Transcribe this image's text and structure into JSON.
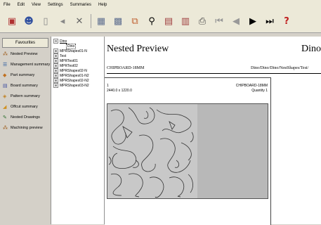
{
  "menu": [
    "File",
    "Edit",
    "View",
    "Settings",
    "Summaries",
    "Help"
  ],
  "favourites": {
    "title": "Favourites",
    "items": [
      {
        "label": "Nested Preview",
        "icon": "nested-preview-icon"
      },
      {
        "label": "Management summary",
        "icon": "management-summary-icon"
      },
      {
        "label": "Part summary",
        "icon": "part-summary-icon"
      },
      {
        "label": "Board summary",
        "icon": "board-summary-icon"
      },
      {
        "label": "Pattern summary",
        "icon": "pattern-summary-icon"
      },
      {
        "label": "Offcut summary",
        "icon": "offcut-summary-icon"
      },
      {
        "label": "Nested Drawings",
        "icon": "nested-drawings-icon"
      },
      {
        "label": "Machining preview",
        "icon": "machining-preview-icon"
      }
    ]
  },
  "tree": [
    {
      "label": "Dino",
      "sign": "⊟"
    },
    {
      "label": "Dino",
      "sign": ""
    },
    {
      "label": "MPRShapes01-N",
      "sign": "⊞"
    },
    {
      "label": "Test",
      "sign": "⊞"
    },
    {
      "label": "MPRTest01",
      "sign": "⊞"
    },
    {
      "label": "MPRTest02",
      "sign": "⊞"
    },
    {
      "label": "MPRShapes02-N",
      "sign": "⊞"
    },
    {
      "label": "MPRShapes01-N2",
      "sign": "⊞"
    },
    {
      "label": "MPRShapes02-N2",
      "sign": "⊞"
    },
    {
      "label": "MPRShapes03-N2",
      "sign": "⊞"
    }
  ],
  "preview": {
    "title": "Nested Preview",
    "title_right": "Dino",
    "material": "CHIPBOARD-18MM",
    "path": "Dino/Dino/Dino/NestShapes/Test/",
    "sheet": {
      "index": "1",
      "dims": "2440.0 x 1220.0",
      "material": "CHIPBOARD-18MM",
      "quantity": "Quantity 1"
    }
  }
}
